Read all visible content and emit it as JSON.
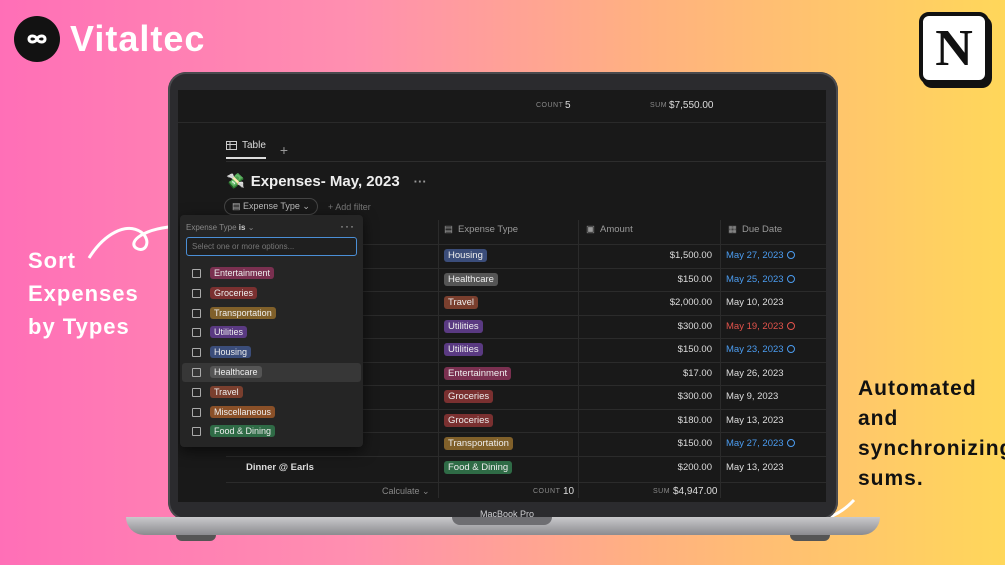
{
  "brand": {
    "name": "Vitaltec"
  },
  "notion": {
    "letter": "N"
  },
  "callouts": {
    "left": [
      "Sort",
      "Expenses",
      "by Types"
    ],
    "right": [
      "Automated",
      "and",
      "synchronizing",
      "sums."
    ]
  },
  "laptop": {
    "model": "MacBook Pro"
  },
  "colors": {
    "Housing": "#3b4d7a",
    "Healthcare": "#555555",
    "Travel": "#7a3f2e",
    "Utilities": "#5a3a82",
    "Entertainment": "#7a3050",
    "Groceries": "#7a3030",
    "Transportation": "#80602a",
    "Food & Dining": "#2f6b46",
    "Miscellaneous": "#8a5028"
  },
  "top_summary": {
    "count_label": "COUNT",
    "count_value": "5",
    "sum_label": "SUM",
    "sum_value": "$7,550.00"
  },
  "view": {
    "tab_label": "Table",
    "add_tab": "+"
  },
  "database": {
    "title_emoji": "💸",
    "title": "Expenses- May, 2023",
    "more": "···"
  },
  "filters": {
    "chip_label": "Expense Type",
    "add_filter": "+ Add filter"
  },
  "columns": {
    "type": "Expense Type",
    "amount": "Amount",
    "due": "Due Date"
  },
  "dropdown": {
    "header_prop": "Expense Type",
    "header_op": "is",
    "more": "···",
    "placeholder": "Select one or more options...",
    "options": [
      "Entertainment",
      "Groceries",
      "Transportation",
      "Utilities",
      "Housing",
      "Healthcare",
      "Travel",
      "Miscellaneous",
      "Food & Dining"
    ],
    "highlighted": "Healthcare"
  },
  "rows": [
    {
      "name": "",
      "type": "Housing",
      "amount": "$1,500.00",
      "due": "May 27, 2023",
      "status": "blue"
    },
    {
      "name": "",
      "type": "Healthcare",
      "amount": "$150.00",
      "due": "May 25, 2023",
      "status": "blue"
    },
    {
      "name": "",
      "type": "Travel",
      "amount": "$2,000.00",
      "due": "May 10, 2023",
      "status": "none"
    },
    {
      "name": "",
      "type": "Utilities",
      "amount": "$300.00",
      "due": "May 19, 2023",
      "status": "red"
    },
    {
      "name": "",
      "type": "Utilities",
      "amount": "$150.00",
      "due": "May 23, 2023",
      "status": "blue"
    },
    {
      "name": "",
      "type": "Entertainment",
      "amount": "$17.00",
      "due": "May 26, 2023",
      "status": "none"
    },
    {
      "name": "",
      "type": "Groceries",
      "amount": "$300.00",
      "due": "May 9, 2023",
      "status": "none"
    },
    {
      "name": "",
      "type": "Groceries",
      "amount": "$180.00",
      "due": "May 13, 2023",
      "status": "none"
    },
    {
      "name": "",
      "type": "Transportation",
      "amount": "$150.00",
      "due": "May 27, 2023",
      "status": "blue"
    },
    {
      "name": "Dinner @ Earls",
      "type": "Food & Dining",
      "amount": "$200.00",
      "due": "May 13, 2023",
      "status": "none"
    }
  ],
  "footer": {
    "calculate": "Calculate",
    "count_label": "COUNT",
    "count_value": "10",
    "sum_label": "SUM",
    "sum_value": "$4,947.00"
  }
}
